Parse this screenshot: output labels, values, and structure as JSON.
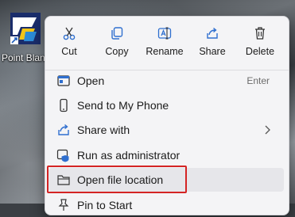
{
  "desktop": {
    "icon_label": "Point Blank",
    "icon_name": "point-blank-game-icon"
  },
  "context_menu": {
    "toolbar": [
      {
        "label": "Cut",
        "icon": "scissors-icon"
      },
      {
        "label": "Copy",
        "icon": "copy-icon"
      },
      {
        "label": "Rename",
        "icon": "rename-icon"
      },
      {
        "label": "Share",
        "icon": "share-icon"
      },
      {
        "label": "Delete",
        "icon": "trash-icon"
      }
    ],
    "items": [
      {
        "label": "Open",
        "shortcut": "Enter",
        "icon": "open-icon"
      },
      {
        "label": "Send to My Phone",
        "icon": "phone-icon"
      },
      {
        "label": "Share with",
        "icon": "share-icon",
        "submenu": true
      },
      {
        "label": "Run as administrator",
        "icon": "shield-icon"
      },
      {
        "label": "Open file location",
        "icon": "folder-icon",
        "highlighted": true
      },
      {
        "label": "Pin to Start",
        "icon": "pin-icon"
      }
    ]
  },
  "colors": {
    "menu_bg": "#f4f4f6",
    "accent": "#2f6fcf",
    "annotation_border": "#d42424"
  }
}
